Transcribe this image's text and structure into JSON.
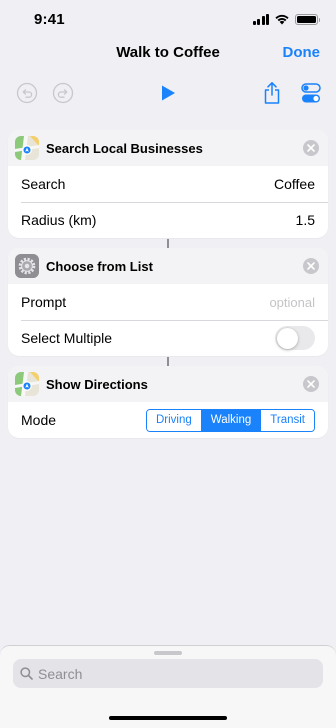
{
  "status_bar": {
    "time": "9:41",
    "icons": [
      "cellular-signal-icon",
      "wifi-icon",
      "battery-icon"
    ]
  },
  "nav": {
    "title": "Walk to Coffee",
    "done_label": "Done"
  },
  "toolbar": {
    "icons": [
      "undo-icon",
      "redo-icon",
      "play-icon",
      "share-icon",
      "settings-toggle-icon"
    ]
  },
  "actions": [
    {
      "title": "Search Local Businesses",
      "icon": "maps-app-icon",
      "rows": [
        {
          "label": "Search",
          "value": "Coffee"
        },
        {
          "label": "Radius (km)",
          "value": "1.5"
        }
      ]
    },
    {
      "title": "Choose from List",
      "icon": "settings-gear-icon",
      "rows": [
        {
          "label": "Prompt",
          "placeholder": "optional"
        },
        {
          "label": "Select Multiple",
          "toggle_on": false
        }
      ]
    },
    {
      "title": "Show Directions",
      "icon": "maps-app-icon",
      "rows": [
        {
          "label": "Mode",
          "options": [
            "Driving",
            "Walking",
            "Transit"
          ],
          "selected": "Walking"
        }
      ]
    }
  ],
  "bottom_sheet": {
    "search_placeholder": "Search"
  },
  "colors": {
    "accent": "#1A82FB",
    "background": "#EFEFF4",
    "card_header": "#F3F3F5",
    "toggle_off": "#E9E9EB"
  }
}
